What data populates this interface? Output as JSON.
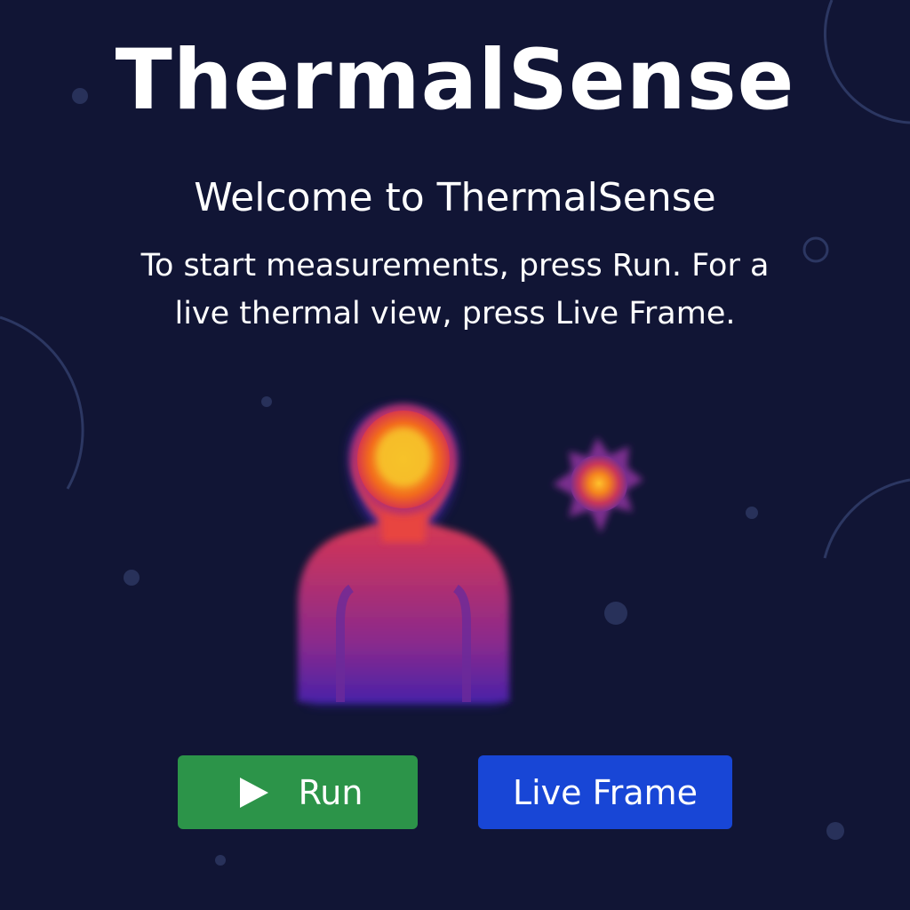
{
  "app": {
    "title": "ThermalSense"
  },
  "welcome": {
    "heading": "Welcome to ThermalSense",
    "text_line1": "To start measurements, press Run. For a",
    "text_line2": "live thermal view, press Live Frame."
  },
  "actions": {
    "run_label": "Run",
    "live_frame_label": "Live Frame"
  },
  "icons": {
    "run": "play-icon",
    "illustration": "thermal-person-icon",
    "heat_spot": "heat-spot-icon"
  },
  "colors": {
    "background": "#111535",
    "run_button": "#2c9449",
    "live_frame_button": "#1846d6",
    "text": "#ffffff"
  }
}
